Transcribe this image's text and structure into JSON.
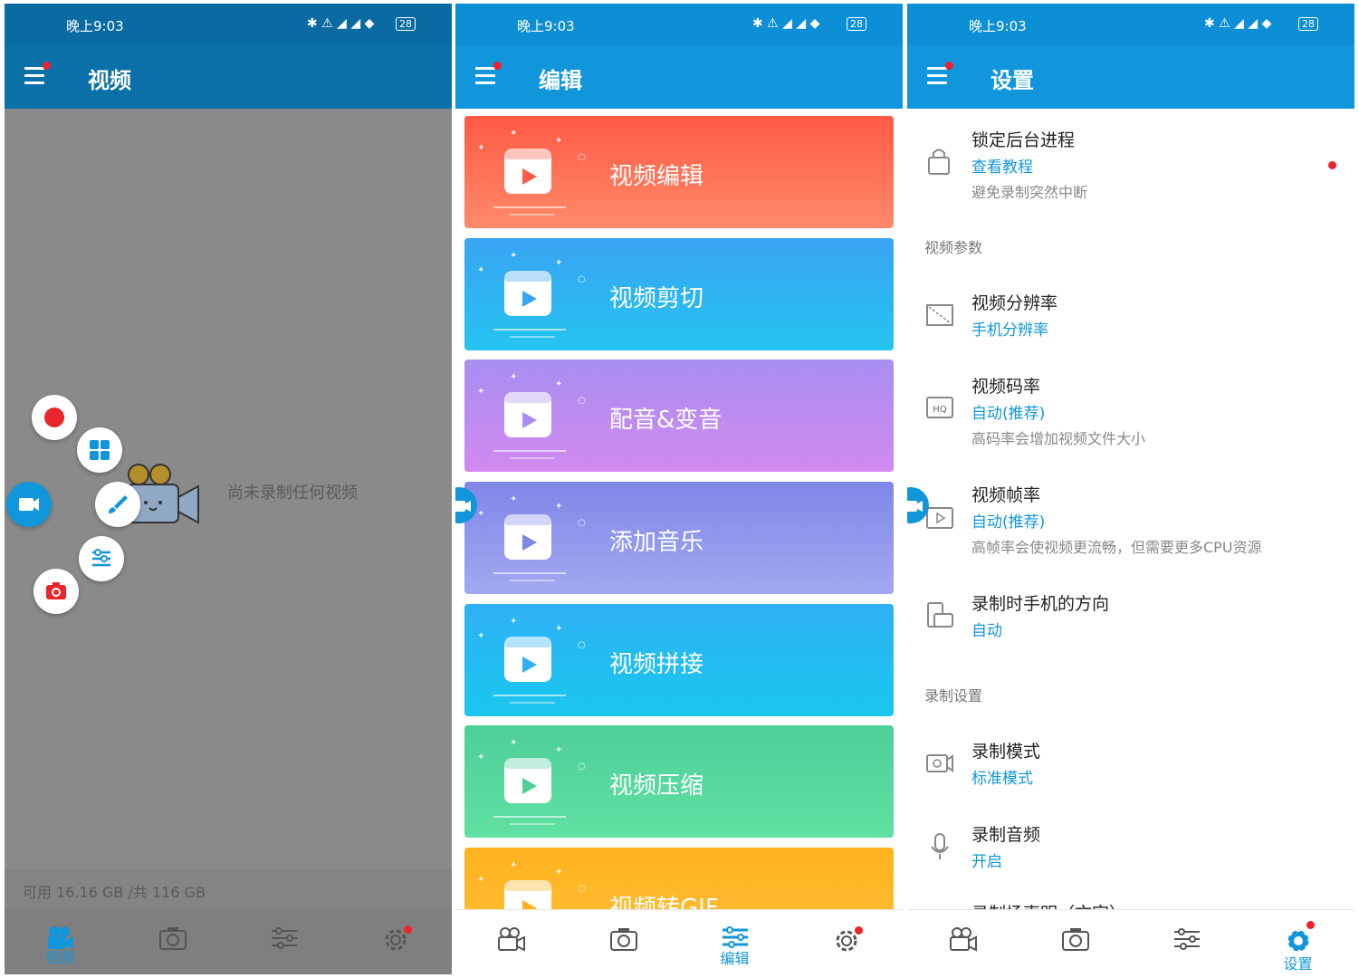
{
  "status_bar": {
    "time": "晚上9:03",
    "battery": "28"
  },
  "panel_video": {
    "title": "视频",
    "empty_text": "尚未录制任何视频",
    "storage_text": "可用 16.16 GB /共 116 GB",
    "fab_icons": [
      "record-icon",
      "grid-icon",
      "camera-video-icon",
      "brush-icon",
      "sliders-icon",
      "screenshot-icon"
    ]
  },
  "panel_edit": {
    "title": "编辑",
    "cards": [
      {
        "label": "视频编辑",
        "icon": "video-edit-icon",
        "color_top": "#ff5a45",
        "color_bottom": "#ff8a6a"
      },
      {
        "label": "视频剪切",
        "icon": "video-cut-icon",
        "color_top": "#39a4f3",
        "color_bottom": "#25c4f0"
      },
      {
        "label": "配音&变音",
        "icon": "voice-change-icon",
        "color_top": "#a88ef0",
        "color_bottom": "#d18af0"
      },
      {
        "label": "添加音乐",
        "icon": "music-icon",
        "color_top": "#7f86e8",
        "color_bottom": "#a3a9f0"
      },
      {
        "label": "视频拼接",
        "icon": "video-join-icon",
        "color_top": "#2fb1f4",
        "color_bottom": "#19c7ee"
      },
      {
        "label": "视频压缩",
        "icon": "video-compress-icon",
        "color_top": "#4ecf9a",
        "color_bottom": "#60e0a2"
      },
      {
        "label": "视频转GIF",
        "icon": "video-gif-icon",
        "color_top": "#ffb21e",
        "color_bottom": "#ffc23a"
      }
    ]
  },
  "panel_settings": {
    "title": "设置",
    "lock": {
      "title": "锁定后台进程",
      "link": "查看教程",
      "desc": "避免录制突然中断"
    },
    "section_video": "视频参数",
    "resolution": {
      "title": "视频分辨率",
      "value": "手机分辨率"
    },
    "bitrate": {
      "title": "视频码率",
      "value": "自动(推荐)",
      "desc": "高码率会增加视频文件大小"
    },
    "framerate": {
      "title": "视频帧率",
      "value": "自动(推荐)",
      "desc": "高帧率会使视频更流畅，但需要更多CPU资源"
    },
    "orientation": {
      "title": "录制时手机的方向",
      "value": "自动"
    },
    "section_record": "录制设置",
    "mode": {
      "title": "录制模式",
      "value": "标准模式"
    },
    "audio": {
      "title": "录制音频",
      "value": "开启"
    },
    "next_partial": "录制场声明（文字）"
  },
  "nav": {
    "video": "视频",
    "edit": "编辑",
    "settings": "设置"
  },
  "colors": {
    "primary": "#1296db",
    "notify": "#f0212b"
  }
}
